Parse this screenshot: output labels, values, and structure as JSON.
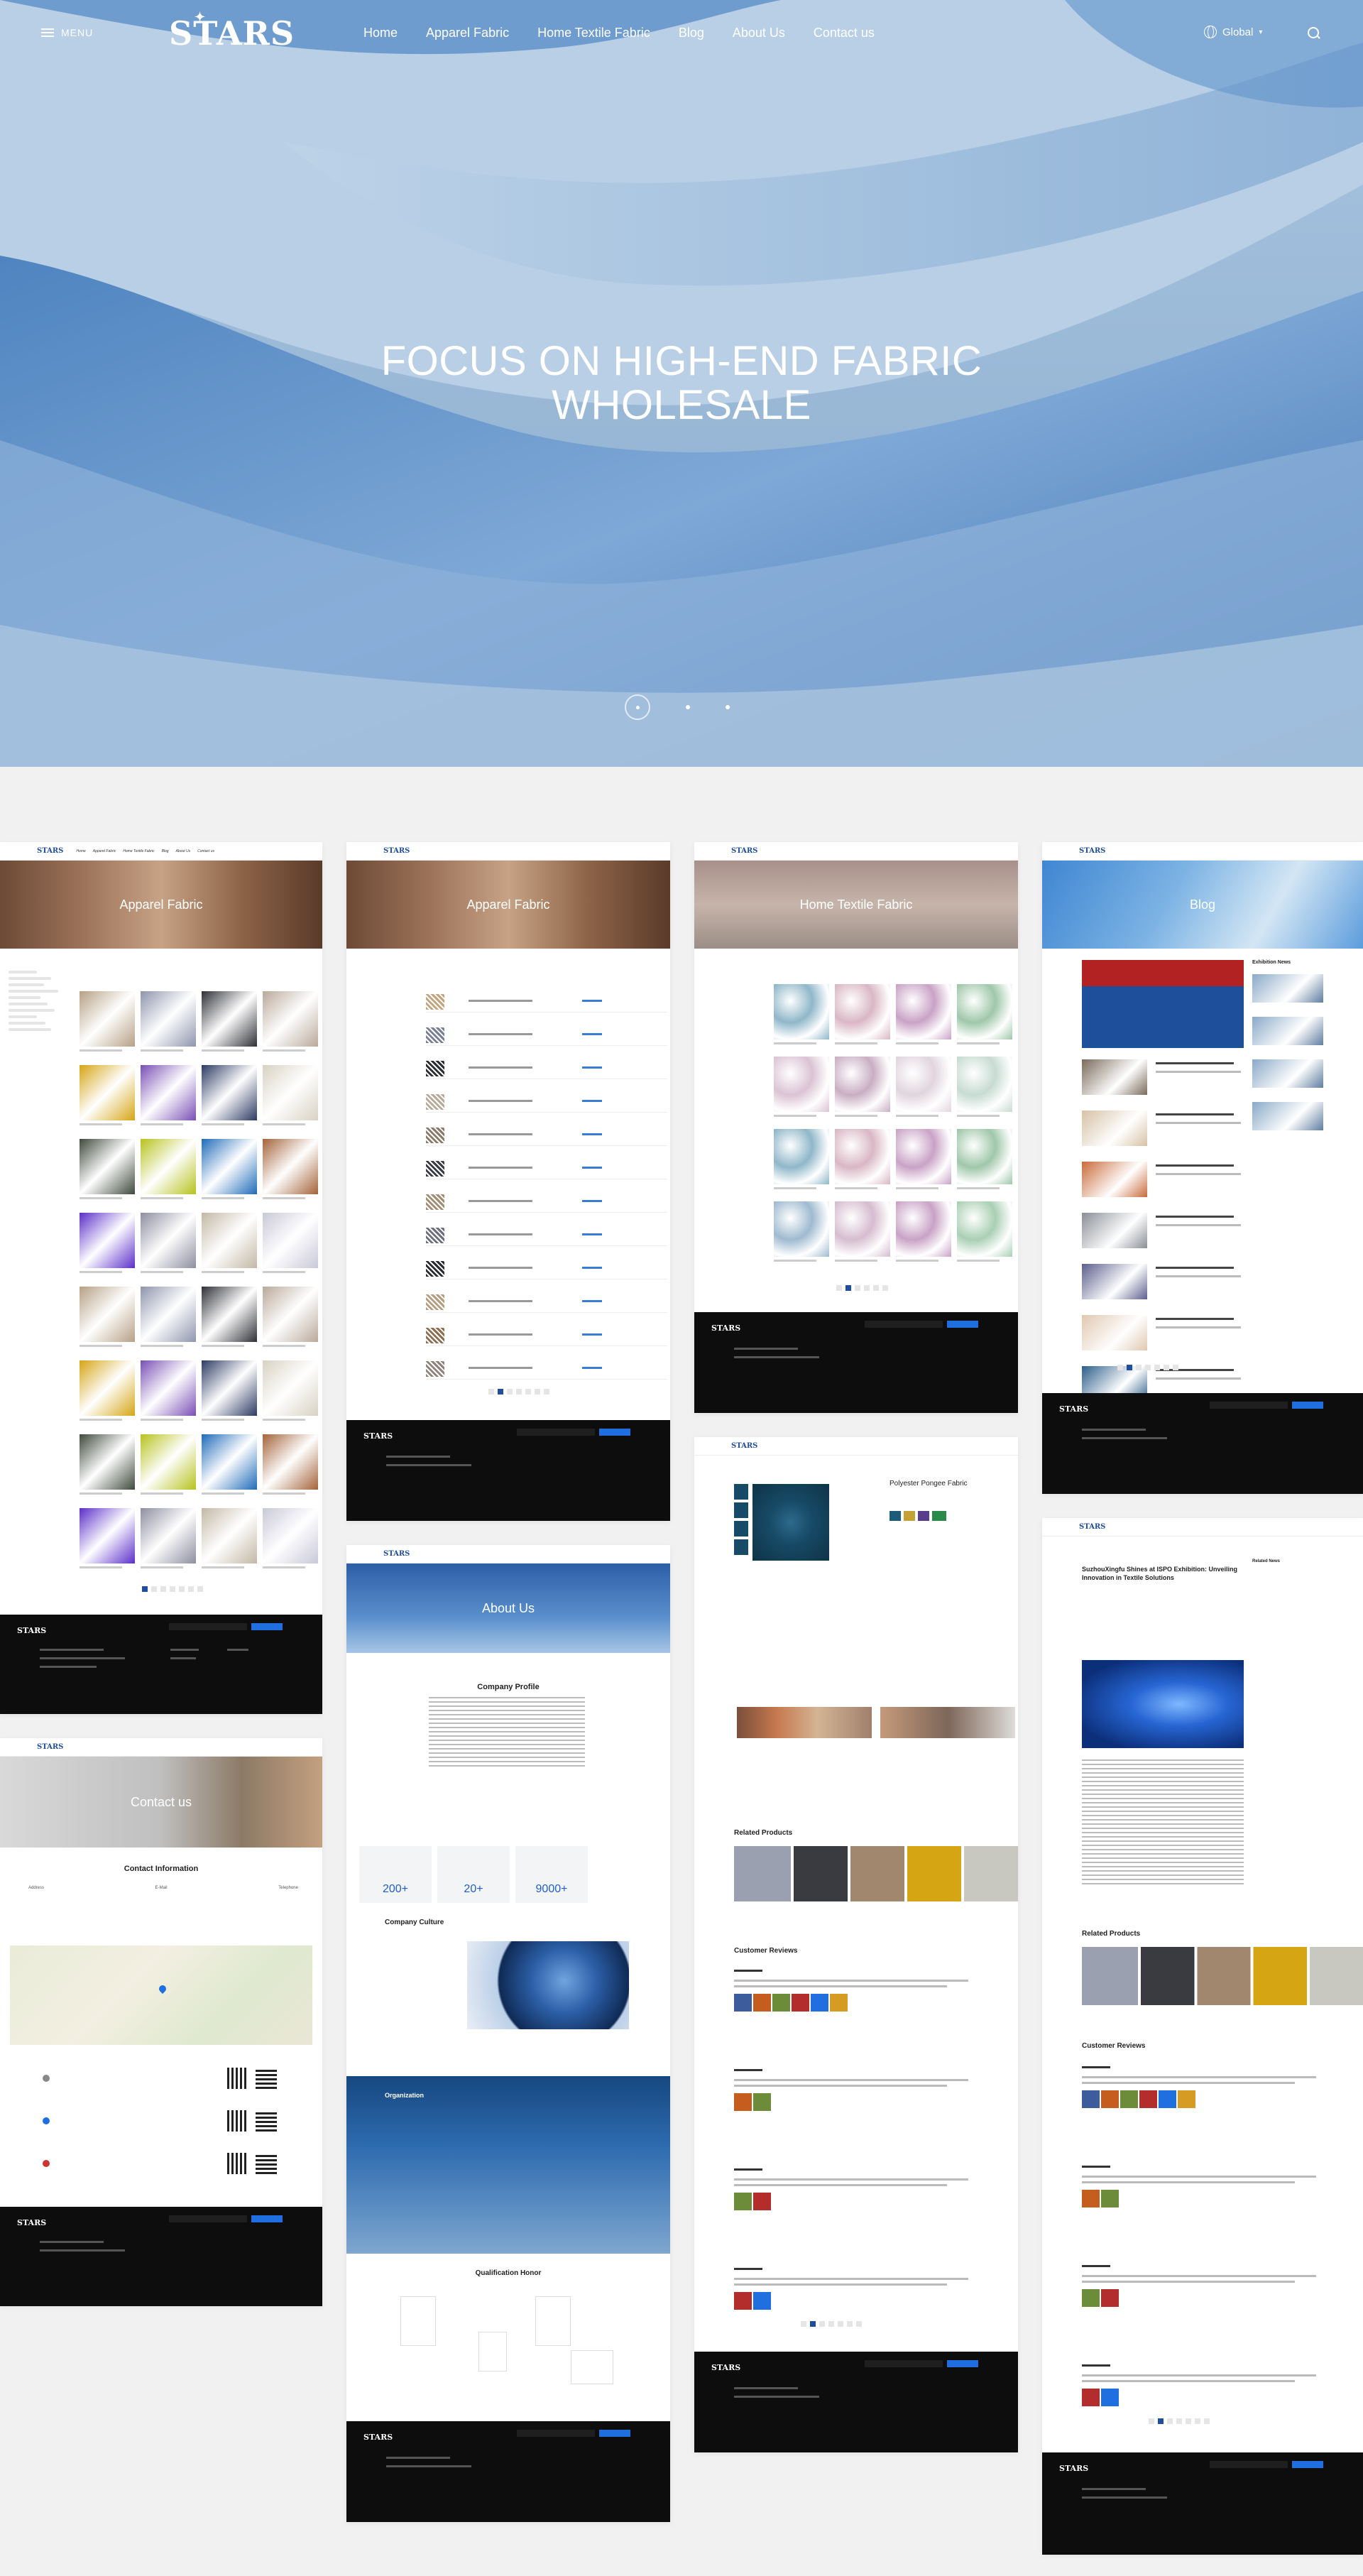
{
  "header": {
    "menu_label": "MENU",
    "logo": "STARS",
    "nav": [
      "Home",
      "Apparel Fabric",
      "Home Textile Fabric",
      "Blog",
      "About Us",
      "Contact us"
    ],
    "global_label": "Global",
    "icons": [
      "hamburger-icon",
      "globe-icon",
      "chevron-down-icon",
      "search-icon"
    ]
  },
  "hero": {
    "title_line1": "FOCUS ON HIGH-END FABRIC",
    "title_line2": "WHOLESALE",
    "slides_total": 3,
    "active_slide": 1
  },
  "mock_pages": {
    "logo": "STARS",
    "apparel_banner": "Apparel Fabric",
    "home_textile_banner": "Home Textile Fabric",
    "blog_banner": "Blog",
    "about_banner": "About Us",
    "contact_banner": "Contact us",
    "product_title": "Polyester Pongee Fabric",
    "company_profile": "Company Profile",
    "stats": [
      "200+",
      "20+",
      "9000+"
    ],
    "company_culture": "Company Culture",
    "organization": "Organization",
    "qualification": "Qualification Honor",
    "contact_info": "Contact Information",
    "contact_cards": [
      "Address",
      "E-Mail",
      "Telephone"
    ],
    "related_products": "Related Products",
    "customer_reviews": "Customer Reviews",
    "blog_article_title": "SuzhouXingfu Shines at ISPO Exhibition: Unveiling Innovation in Textile Solutions",
    "related_news": "Related News",
    "exhibition_news": "Exhibition News"
  },
  "colors": {
    "brand_blue": "#1f4e9e",
    "accent_blue": "#1f6fe0",
    "footer_black": "#0d0d0d",
    "page_bg": "#f1f1f1"
  }
}
